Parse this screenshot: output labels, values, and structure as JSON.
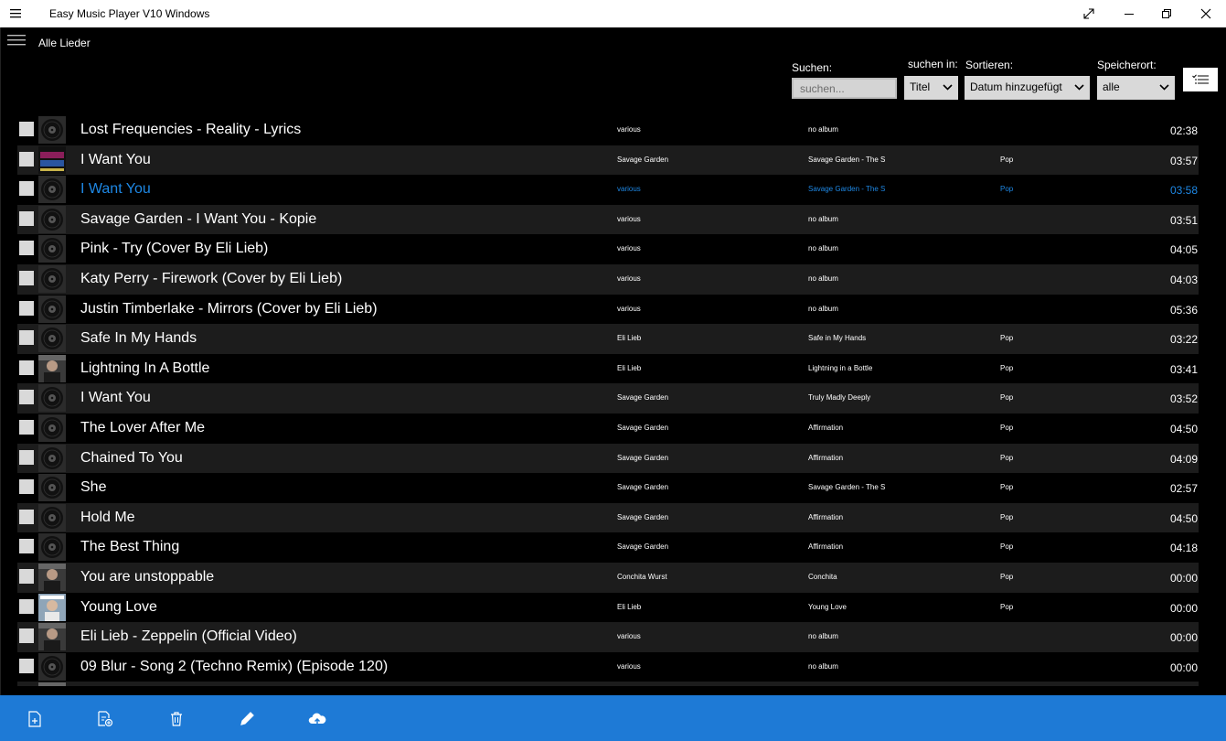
{
  "window": {
    "title": "Easy Music Player V10 Windows"
  },
  "header": {
    "page_title": "Alle Lieder"
  },
  "filters": {
    "search_label": "Suchen:",
    "search_placeholder": "suchen...",
    "search_in_label": "suchen in:",
    "search_in_value": "Titel",
    "sort_label": "Sortieren:",
    "sort_value": "Datum hinzugefügt",
    "location_label": "Speicherort:",
    "location_value": "alle"
  },
  "songs": [
    {
      "title": "Lost Frequencies  - Reality - Lyrics",
      "artist": "various",
      "album": "no album",
      "genre": "",
      "duration": "02:38",
      "cover": "disc-icon"
    },
    {
      "title": "I Want You",
      "artist": "Savage Garden",
      "album": "Savage Garden - The S",
      "genre": "Pop",
      "duration": "03:57",
      "cover": "savage-garden-cover"
    },
    {
      "title": "I Want You",
      "artist": "various",
      "album": "Savage Garden - The S",
      "genre": "Pop",
      "duration": "03:58",
      "cover": "disc-icon",
      "selected": true
    },
    {
      "title": "Savage Garden - I Want You - Kopie",
      "artist": "various",
      "album": "no album",
      "genre": "",
      "duration": "03:51",
      "cover": "disc-icon"
    },
    {
      "title": "Pink - Try (Cover By Eli Lieb)",
      "artist": "various",
      "album": "no album",
      "genre": "",
      "duration": "04:05",
      "cover": "disc-icon"
    },
    {
      "title": "Katy Perry - Firework (Cover by Eli Lieb)",
      "artist": "various",
      "album": "no album",
      "genre": "",
      "duration": "04:03",
      "cover": "disc-icon"
    },
    {
      "title": "Justin Timberlake - Mirrors (Cover by Eli Lieb)",
      "artist": "various",
      "album": "no album",
      "genre": "",
      "duration": "05:36",
      "cover": "disc-icon"
    },
    {
      "title": "Safe In My Hands",
      "artist": "Eli Lieb",
      "album": "Safe in My Hands",
      "genre": "Pop",
      "duration": "03:22",
      "cover": "disc-icon"
    },
    {
      "title": "Lightning In A Bottle",
      "artist": "Eli Lieb",
      "album": "Lightning in a Bottle",
      "genre": "Pop",
      "duration": "03:41",
      "cover": "photo-cover"
    },
    {
      "title": "I Want You",
      "artist": "Savage Garden",
      "album": "Truly Madly Deeply",
      "genre": "Pop",
      "duration": "03:52",
      "cover": "disc-icon"
    },
    {
      "title": "The Lover After Me",
      "artist": "Savage Garden",
      "album": "Affirmation",
      "genre": "Pop",
      "duration": "04:50",
      "cover": "disc-icon"
    },
    {
      "title": "Chained To You",
      "artist": "Savage Garden",
      "album": "Affirmation",
      "genre": "Pop",
      "duration": "04:09",
      "cover": "disc-icon"
    },
    {
      "title": "She",
      "artist": "Savage Garden",
      "album": "Savage Garden - The S",
      "genre": "Pop",
      "duration": "02:57",
      "cover": "disc-icon"
    },
    {
      "title": "Hold Me",
      "artist": "Savage Garden",
      "album": "Affirmation",
      "genre": "Pop",
      "duration": "04:50",
      "cover": "disc-icon"
    },
    {
      "title": "The Best Thing",
      "artist": "Savage Garden",
      "album": "Affirmation",
      "genre": "Pop",
      "duration": "04:18",
      "cover": "disc-icon"
    },
    {
      "title": "You are unstoppable",
      "artist": "Conchita Wurst",
      "album": "Conchita",
      "genre": "Pop",
      "duration": "00:00",
      "cover": "photo-cover"
    },
    {
      "title": "Young Love",
      "artist": "Eli Lieb",
      "album": "Young Love",
      "genre": "Pop",
      "duration": "00:00",
      "cover": "young-love-cover"
    },
    {
      "title": "Eli Lieb - Zeppelin (Official Video)",
      "artist": "various",
      "album": "no album",
      "genre": "",
      "duration": "00:00",
      "cover": "photo-cover"
    },
    {
      "title": "09 Blur - Song 2 (Techno Remix) (Episode 120)",
      "artist": "various",
      "album": "no album",
      "genre": "",
      "duration": "00:00",
      "cover": "disc-icon"
    },
    {
      "title": "",
      "artist": "",
      "album": "",
      "genre": "",
      "duration": "",
      "cover": "photo-cover"
    }
  ],
  "commandbar": {
    "buttons": [
      "add-file-icon",
      "add-folder-icon",
      "delete-icon",
      "edit-icon",
      "cloud-upload-icon"
    ]
  },
  "colors": {
    "accent": "#1e7ad6",
    "selected_text": "#1e88e5",
    "row_alt": "#1c1c1c"
  }
}
